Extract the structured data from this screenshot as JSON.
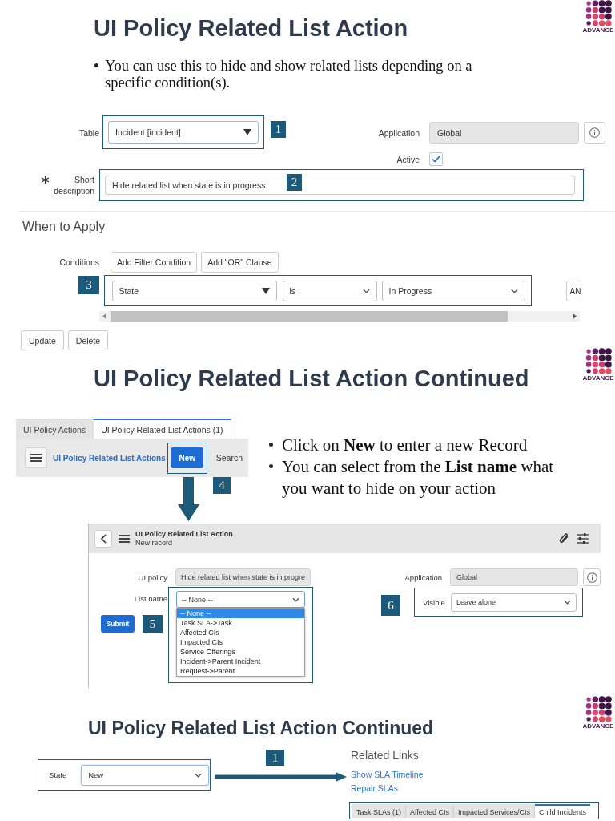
{
  "slides": [
    {
      "kind": "policy_form",
      "title": "UI Policy Related List Action",
      "logo_text": "ADVANCE",
      "bullets": [
        "You can use this to hide and show related lists depending on a specific condition(s)."
      ],
      "fields": {
        "table": {
          "label": "Table",
          "value": "Incident [incident]",
          "callout": "1"
        },
        "application": {
          "label": "Application",
          "value": "Global"
        },
        "active": {
          "label": "Active",
          "checked": true
        },
        "short_description": {
          "label": "Short description",
          "required": true,
          "value": "Hide related list when state is in progress",
          "callout": "2"
        }
      },
      "section_title": "When to Apply",
      "conditions": {
        "label": "Conditions",
        "buttons": [
          "Add Filter Condition",
          "Add \"OR\" Clause"
        ],
        "callout": "3",
        "field": "State",
        "operator": "is",
        "value": "In Progress",
        "next_button": "AN"
      },
      "actions": [
        "Update",
        "Delete"
      ]
    },
    {
      "kind": "related_list_action",
      "title": "UI Policy Related List Action Continued",
      "logo_text": "ADVANCE",
      "tabs": [
        {
          "label": "UI Policy Actions",
          "selected": false
        },
        {
          "label": "UI Policy Related List Actions (1)",
          "selected": true
        }
      ],
      "list_toolbar": {
        "title": "UI Policy Related List Actions",
        "new_button": "New",
        "callout": "4",
        "search": "Search"
      },
      "bullets": [
        "Click on **New** to enter a new Record",
        "You can select from the **List name** what you want to hide on your action"
      ],
      "record": {
        "title": "UI Policy Related List Action",
        "subtitle": "New record",
        "ui_policy": {
          "label": "UI policy",
          "value": "Hide related list when state is in progre"
        },
        "list_name": {
          "label": "List name",
          "value": "-- None --",
          "callout": "5",
          "options": [
            {
              "label": "-- None --",
              "selected": true
            },
            {
              "label": "Task SLA->Task",
              "selected": false
            },
            {
              "label": "Affected CIs",
              "selected": false
            },
            {
              "label": "Impacted CIs",
              "selected": false
            },
            {
              "label": "Service Offerings",
              "selected": false
            },
            {
              "label": "Incident->Parent Incident",
              "selected": false
            },
            {
              "label": "Request->Parent",
              "selected": false
            }
          ]
        },
        "submit": "Submit",
        "application": {
          "label": "Application",
          "value": "Global"
        },
        "visible": {
          "label": "Visible",
          "value": "Leave alone",
          "callout": "6"
        }
      }
    },
    {
      "kind": "related_links",
      "title": "UI Policy Related List Action Continued",
      "logo_text": "ADVANCE",
      "state": {
        "label": "State",
        "value": "New"
      },
      "callout": "1",
      "related_links": {
        "title": "Related Links",
        "links": [
          "Show SLA Timeline",
          "Repair SLAs"
        ]
      },
      "tabs": [
        {
          "label": "Task SLAs (1)",
          "selected": false
        },
        {
          "label": "Affected CIs",
          "selected": false
        },
        {
          "label": "Impacted Services/CIs",
          "selected": false
        },
        {
          "label": "Child Incidents",
          "selected": true
        }
      ]
    }
  ]
}
